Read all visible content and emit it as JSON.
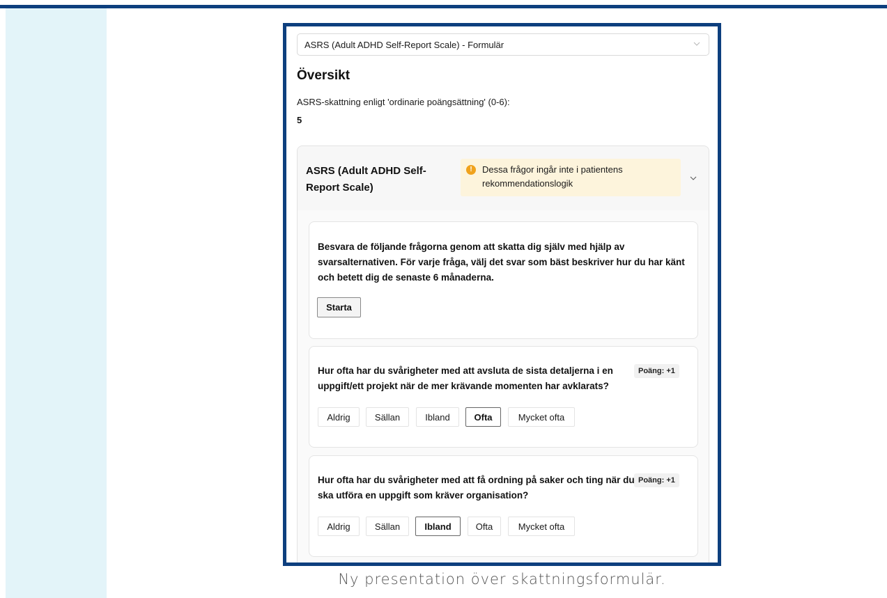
{
  "colors": {
    "accent": "#0d3f7e",
    "side_panel": "#e3f4f9",
    "warning_bg": "#fdf4dc",
    "warning_icon": "#f0a21c"
  },
  "form_select": {
    "value": "ASRS (Adult ADHD Self-Report Scale) - Formulär",
    "icon": "chevron-down-icon"
  },
  "overview": {
    "title": "Översikt",
    "score_label": "ASRS-skattning enligt 'ordinarie poängsättning' (0-6):",
    "score_value": "5"
  },
  "accordion": {
    "title": "ASRS (Adult ADHD Self-Report Scale)",
    "warning_icon": "!",
    "warning_text": "Dessa frågor ingår inte i patientens rekommendationslogik",
    "icon": "chevron-down-icon",
    "intro": {
      "text": "Besvara de följande frågorna genom att skatta dig själv med hjälp av svarsalternativen. För varje fråga, välj det svar som bäst beskriver hur du har känt och betett dig de senaste 6 månaderna.",
      "start_label": "Starta"
    },
    "questions": [
      {
        "text": "Hur ofta har du svårigheter med att avsluta de sista detaljerna i en uppgift/ett projekt när de mer krävande momenten har avklarats?",
        "points": "Poäng: +1",
        "options": [
          "Aldrig",
          "Sällan",
          "Ibland",
          "Ofta",
          "Mycket ofta"
        ],
        "selected": "Ofta"
      },
      {
        "text": "Hur ofta har du svårigheter med att få ordning på saker och ting när du ska utföra en uppgift som kräver organisation?",
        "points": "Poäng: +1",
        "options": [
          "Aldrig",
          "Sällan",
          "Ibland",
          "Ofta",
          "Mycket ofta"
        ],
        "selected": "Ibland"
      }
    ]
  },
  "caption": "Ny presentation över skattningsformulär."
}
